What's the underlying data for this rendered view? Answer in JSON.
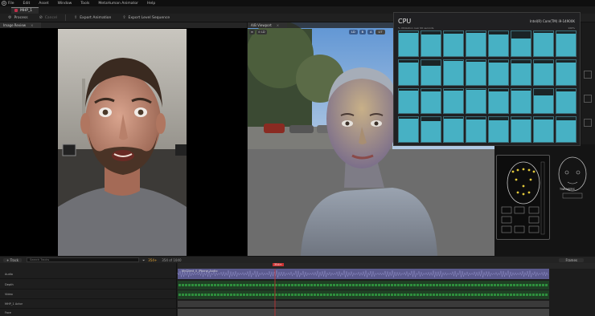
{
  "menu": {
    "items": [
      "File",
      "Edit",
      "Asset",
      "Window",
      "Tools",
      "MetaHuman Animator",
      "Help"
    ]
  },
  "tab": {
    "label": "MHP_1"
  },
  "toolbar": {
    "process": "Process",
    "cancel": "Cancel",
    "export_anim": "Export Animation",
    "export_seq": "Export Level Sequence"
  },
  "image_review": {
    "title": "Image Review"
  },
  "viewport": {
    "title": "A/B Viewport",
    "badges": [
      "LD",
      "B",
      "A",
      "LIT"
    ]
  },
  "cpu": {
    "title": "CPU",
    "model": "Intel(R) Core(TM) i9-14900K",
    "subtitle": "% Utilization over 60 seconds",
    "pct": "100%",
    "core_levels": [
      0.92,
      0.86,
      0.9,
      0.95,
      0.88,
      0.7,
      0.93,
      0.89,
      0.91,
      0.75,
      0.96,
      0.94,
      0.9,
      0.87,
      0.85,
      0.88,
      0.93,
      0.9,
      0.92,
      0.95,
      0.88,
      0.91,
      0.72,
      0.9,
      0.94,
      0.86,
      0.93,
      0.9,
      0.89,
      0.91,
      0.9,
      0.87
    ]
  },
  "rig": {
    "label": "TWEAKERS"
  },
  "timeline": {
    "add_track": "+ Track",
    "search_placeholder": "Search Tracks",
    "frame_current": "354+",
    "frame_range": "354 of 1040",
    "frames_label": "Frames",
    "playhead_label": "354+",
    "tracks": [
      "Audio",
      "Depth",
      "Video",
      "MHP_1 Actor",
      "Face"
    ],
    "audio_clip": "MyClient_0_iPhone_Audio"
  },
  "colors": {
    "accent": "#47b1c4",
    "audio": "#5b5a8e",
    "green": "#2e8f3d",
    "playhead": "#cc3333"
  }
}
